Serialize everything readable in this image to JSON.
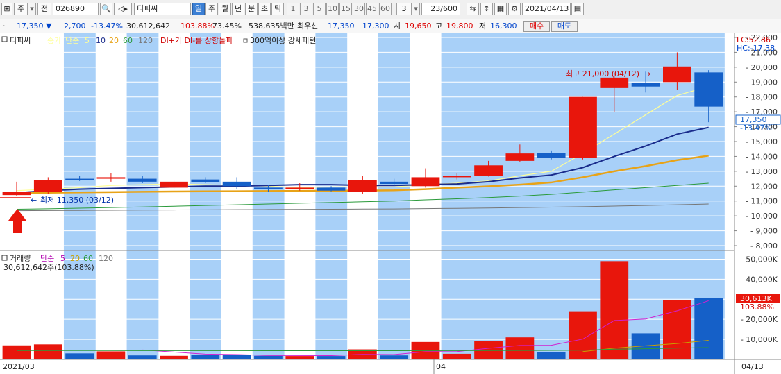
{
  "toolbar": {
    "market_type": "주",
    "prev_label": "전",
    "code": "026890",
    "stock_name": "디피씨",
    "periods": [
      "일",
      "주",
      "월",
      "년",
      "분",
      "초",
      "틱"
    ],
    "selected_period": "일",
    "intervals": [
      "1",
      "3",
      "5",
      "10",
      "15",
      "30",
      "45",
      "60"
    ],
    "interval_value": "3",
    "count": "23/600",
    "date": "2021/04/13"
  },
  "quote": {
    "price": "17,350 ▼",
    "change": "2,700",
    "change_pct": "-13.47%",
    "volume": "30,612,642",
    "volume_ratio": "103.88%",
    "turnover": "73.45%",
    "amount": "538,635백만",
    "best_bid_label": "최우선",
    "best_ask": "17,350",
    "best_bid": "17,300",
    "open_label": "시",
    "open": "19,650",
    "high_label": "고",
    "high": "19,800",
    "low_label": "저",
    "low": "16,300",
    "buy_label": "매수",
    "sell_label": "매도"
  },
  "legend": {
    "name": "디피씨",
    "close_label": "종가",
    "simple_label": "단순",
    "ma": [
      "5",
      "10",
      "20",
      "60",
      "120"
    ],
    "signal1": "DI+가 DI-를 상향돌파",
    "signal2": "300억이상 강세패턴",
    "lc": "LC:52.86",
    "hc": "HC:-17.38"
  },
  "annotations": {
    "max_label": "최고 21,000 (04/12)",
    "min_label": "최저 11,350 (03/12)"
  },
  "price_badge": {
    "price": "17,350",
    "pct": "-13.47%"
  },
  "volume_legend": {
    "title": "거래량",
    "simple_label": "단순",
    "ma": [
      "5",
      "20",
      "60",
      "120"
    ],
    "value": "30,612,642주(103.88%)"
  },
  "volume_badge": {
    "value": "30,613K",
    "pct": "103.88%"
  },
  "xaxis": {
    "left": "2021/03",
    "mid": "04",
    "right": "04/13"
  },
  "colors": {
    "up": "#e8160c",
    "down": "#1560c8",
    "highlight": "#a8d0f8",
    "ma5": "#ffff99",
    "ma10": "#1a2c8c",
    "ma20": "#e8a317",
    "ma60": "#2a9a3a",
    "ma120": "#777777"
  },
  "chart_data": {
    "type": "candlestick",
    "price_axis": {
      "min": 8000,
      "max": 22000,
      "ticks": [
        "8,000",
        "9,000",
        "10,000",
        "11,000",
        "12,000",
        "13,000",
        "14,000",
        "15,000",
        "16,000",
        "17,000",
        "18,000",
        "19,000",
        "20,000",
        "21,000",
        "22,000"
      ]
    },
    "volume_axis": {
      "max": 50000,
      "ticks": [
        "10,000K",
        "20,000K",
        "30,000K",
        "40,000K",
        "50,000K"
      ]
    },
    "candles": [
      {
        "o": 11400,
        "h": 12300,
        "l": 11350,
        "c": 11600,
        "v": 7000,
        "hl": false
      },
      {
        "o": 11600,
        "h": 12600,
        "l": 11500,
        "c": 12400,
        "v": 7500,
        "hl": false
      },
      {
        "o": 12500,
        "h": 12700,
        "l": 12350,
        "c": 12450,
        "v": 3000,
        "hl": true
      },
      {
        "o": 12500,
        "h": 12900,
        "l": 12300,
        "c": 12600,
        "v": 4000,
        "hl": false
      },
      {
        "o": 12500,
        "h": 12700,
        "l": 12200,
        "c": 12300,
        "v": 2000,
        "hl": true
      },
      {
        "o": 11900,
        "h": 12400,
        "l": 11800,
        "c": 12300,
        "v": 1800,
        "hl": false
      },
      {
        "o": 12450,
        "h": 12600,
        "l": 12200,
        "c": 12250,
        "v": 2100,
        "hl": true
      },
      {
        "o": 12300,
        "h": 12600,
        "l": 11800,
        "c": 12000,
        "v": 2300,
        "hl": false
      },
      {
        "o": 11900,
        "h": 12100,
        "l": 11600,
        "c": 11850,
        "v": 1800,
        "hl": true
      },
      {
        "o": 11800,
        "h": 12200,
        "l": 11700,
        "c": 11900,
        "v": 1700,
        "hl": false
      },
      {
        "o": 11900,
        "h": 12000,
        "l": 11650,
        "c": 11700,
        "v": 1700,
        "hl": true
      },
      {
        "o": 11600,
        "h": 12700,
        "l": 11500,
        "c": 12400,
        "v": 5000,
        "hl": false
      },
      {
        "o": 12300,
        "h": 12500,
        "l": 12000,
        "c": 12150,
        "v": 2000,
        "hl": true
      },
      {
        "o": 12000,
        "h": 13200,
        "l": 11900,
        "c": 12600,
        "v": 8700,
        "hl": false
      },
      {
        "o": 12600,
        "h": 12850,
        "l": 12450,
        "c": 12700,
        "v": 2800,
        "hl": true
      },
      {
        "o": 12700,
        "h": 13700,
        "l": 12650,
        "c": 13400,
        "v": 9200,
        "hl": false
      },
      {
        "o": 13700,
        "h": 14800,
        "l": 13600,
        "c": 14200,
        "v": 11000,
        "hl": false
      },
      {
        "o": 14250,
        "h": 14400,
        "l": 13800,
        "c": 13900,
        "v": 3800,
        "hl": false
      },
      {
        "o": 13900,
        "h": 18000,
        "l": 13800,
        "c": 18000,
        "v": 24000,
        "hl": false
      },
      {
        "o": 18600,
        "h": 19600,
        "l": 17000,
        "c": 19300,
        "v": 49000,
        "hl": false
      },
      {
        "o": 18950,
        "h": 19700,
        "l": 18300,
        "c": 18700,
        "v": 13000,
        "hl": false
      },
      {
        "o": 19000,
        "h": 21000,
        "l": 18500,
        "c": 20050,
        "v": 29500,
        "hl": false
      },
      {
        "o": 19650,
        "h": 19800,
        "l": 16300,
        "c": 17350,
        "v": 30612,
        "hl": false
      }
    ],
    "series": [
      {
        "name": "5",
        "values": [
          11700,
          11800,
          11900,
          12050,
          12100,
          12150,
          12100,
          12050,
          12000,
          11900,
          11950,
          11950,
          11950,
          12100,
          12200,
          12350,
          12700,
          13000,
          14200,
          15500,
          16800,
          18100,
          18700
        ]
      },
      {
        "name": "10",
        "values": [
          11550,
          11700,
          11800,
          11850,
          11900,
          11950,
          12000,
          12000,
          12050,
          12100,
          12100,
          12050,
          12050,
          12100,
          12150,
          12300,
          12550,
          12750,
          13250,
          14000,
          14700,
          15500,
          15950
        ]
      },
      {
        "name": "20",
        "values": [
          11550,
          11560,
          11580,
          11600,
          11620,
          11640,
          11650,
          11660,
          11670,
          11680,
          11690,
          11700,
          11720,
          11800,
          11900,
          11990,
          12100,
          12250,
          12600,
          13000,
          13350,
          13750,
          14050
        ]
      },
      {
        "name": "60",
        "values": [
          10450,
          10480,
          10520,
          10560,
          10600,
          10650,
          10700,
          10750,
          10800,
          10850,
          10900,
          10950,
          11000,
          11080,
          11150,
          11230,
          11330,
          11450,
          11600,
          11750,
          11900,
          12050,
          12200
        ]
      },
      {
        "name": "120",
        "values": [
          10350,
          10360,
          10370,
          10380,
          10390,
          10400,
          10410,
          10420,
          10430,
          10440,
          10450,
          10460,
          10470,
          10490,
          10510,
          10530,
          10560,
          10590,
          10620,
          10660,
          10700,
          10750,
          10800
        ]
      }
    ],
    "volume_ma": [
      {
        "name": "5",
        "values": [
          null,
          null,
          null,
          null,
          4700,
          3660,
          2640,
          2440,
          2000,
          1940,
          1920,
          2500,
          2440,
          3840,
          3900,
          5540,
          6940,
          7060,
          10140,
          19400,
          20160,
          24260,
          29260
        ]
      },
      {
        "name": "20",
        "values": [
          null,
          null,
          null,
          null,
          null,
          null,
          null,
          null,
          null,
          null,
          null,
          null,
          null,
          null,
          null,
          null,
          null,
          null,
          3900,
          5600,
          6800,
          7900,
          9500
        ]
      },
      {
        "name": "60",
        "values": [
          4400,
          4420,
          4400,
          4390,
          4380,
          4370,
          4360,
          4350,
          4340,
          4330,
          4320,
          4320,
          4330,
          4360,
          4380,
          4420,
          4460,
          4480,
          4600,
          5100,
          5300,
          5600,
          5900
        ]
      }
    ]
  }
}
